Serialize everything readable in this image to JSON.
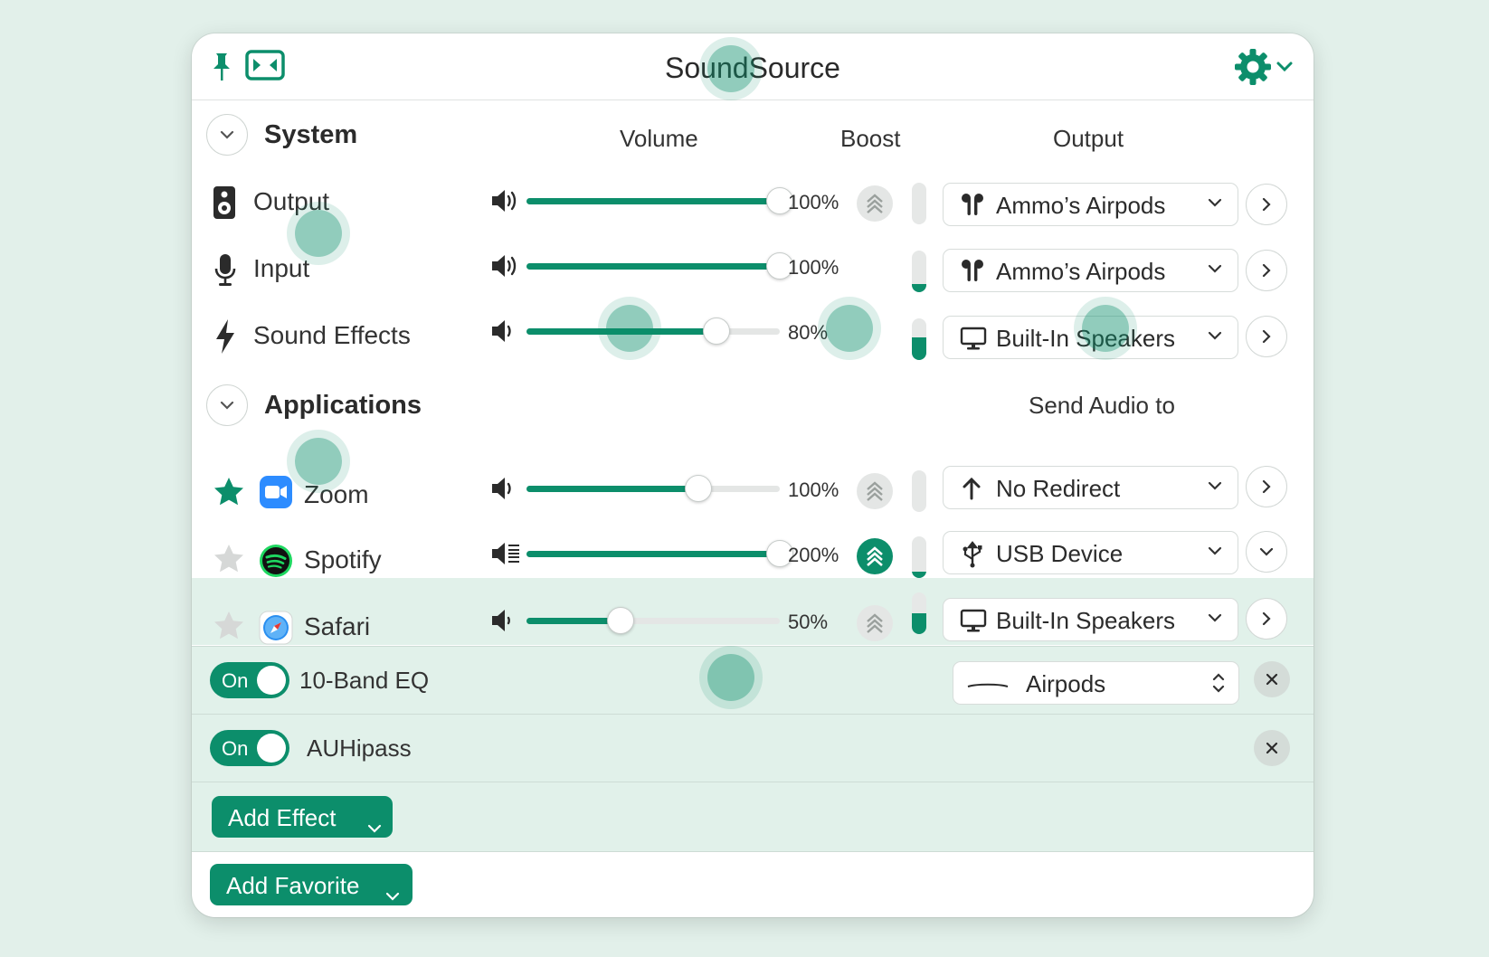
{
  "app": {
    "title": "SoundSource"
  },
  "system": {
    "section_title": "System",
    "columns": {
      "volume": "Volume",
      "boost": "Boost",
      "output": "Output"
    },
    "rows": [
      {
        "label": "Output",
        "icon": "speaker-device-icon",
        "volume_pct": "100%",
        "volume": 1.0,
        "boost_on": false,
        "level": 0.0,
        "device": "Ammo’s Airpods",
        "device_icon": "airpods-icon"
      },
      {
        "label": "Input",
        "icon": "microphone-icon",
        "volume_pct": "100%",
        "volume": 1.0,
        "boost_on": false,
        "level": 0.2,
        "device": "Ammo’s Airpods",
        "device_icon": "airpods-icon"
      },
      {
        "label": "Sound Effects",
        "icon": "lightning-bolt-icon",
        "volume_pct": "80%",
        "volume": 0.75,
        "boost_on": false,
        "level": 0.55,
        "device": "Built-In Speakers",
        "device_icon": "display-icon"
      }
    ]
  },
  "applications": {
    "section_title": "Applications",
    "send_audio_to": "Send Audio to",
    "rows": [
      {
        "label": "Zoom",
        "favorite": true,
        "icon": "zoom-app-icon",
        "volume_pct": "100%",
        "volume": 0.68,
        "boost_on": false,
        "level": 0.0,
        "device": "No Redirect",
        "device_icon": "arrow-up-icon"
      },
      {
        "label": "Spotify",
        "favorite": false,
        "icon": "spotify-app-icon",
        "volume_pct": "200%",
        "volume": 1.0,
        "boost_on": true,
        "level": 0.15,
        "device": "USB Device",
        "device_icon": "usb-icon"
      },
      {
        "label": "Safari",
        "favorite": false,
        "icon": "safari-app-icon",
        "volume_pct": "50%",
        "volume": 0.37,
        "boost_on": false,
        "level": 0.5,
        "device": "Built-In Speakers",
        "device_icon": "display-icon"
      }
    ]
  },
  "effects": [
    {
      "toggle": "On",
      "name": "10-Band EQ",
      "preset": "Airpods"
    },
    {
      "toggle": "On",
      "name": "AUHipass"
    }
  ],
  "buttons": {
    "add_effect": "Add Effect",
    "add_favorite": "Add Favorite"
  },
  "colors": {
    "accent": "#0c8e6b",
    "background": "#e2f0ea",
    "selected_row": "#e1f1ea"
  }
}
